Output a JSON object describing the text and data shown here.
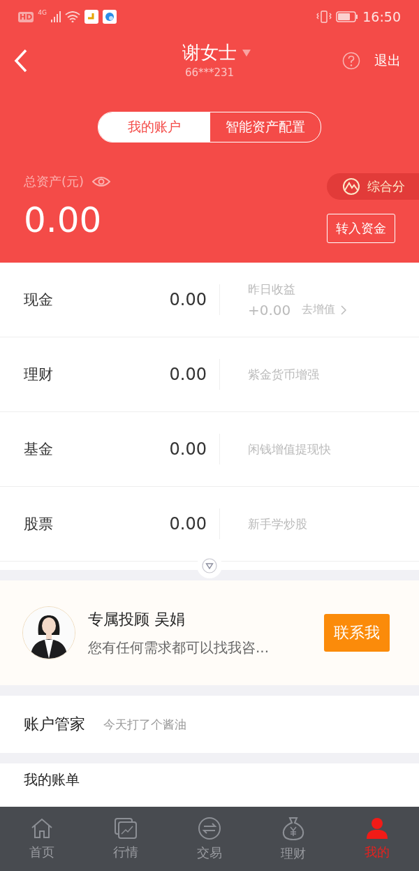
{
  "status_bar": {
    "hd": "HD",
    "network": "4G",
    "time": "16:50"
  },
  "header": {
    "title": "谢女士",
    "account": "66***231",
    "exit": "退出"
  },
  "tabs": [
    {
      "label": "我的账户",
      "selected": true
    },
    {
      "label": "智能资产配置",
      "selected": false
    }
  ],
  "assets": {
    "label": "总资产(元)",
    "value": "0.00",
    "score": "综合分",
    "transfer_button": "转入资金"
  },
  "holdings": [
    {
      "kind": "yield",
      "name": "现金",
      "amount": "0.00",
      "note_label": "昨日收益",
      "note_value": "+0.00",
      "link": "去增值"
    },
    {
      "kind": "tip",
      "name": "理财",
      "amount": "0.00",
      "note": "紫金货币增强"
    },
    {
      "kind": "tip",
      "name": "基金",
      "amount": "0.00",
      "note": "闲钱增值提现快"
    },
    {
      "kind": "tip",
      "name": "股票",
      "amount": "0.00",
      "note": "新手学炒股"
    }
  ],
  "advisor": {
    "title": "专属投顾 吴娟",
    "message": "您有任何需求都可以找我咨...",
    "button": "联系我"
  },
  "manager": {
    "label": "账户管家",
    "note": "今天打了个酱油"
  },
  "bill": {
    "label": "我的账单"
  },
  "nav": [
    {
      "kind": "home",
      "label": "首页",
      "selected": false
    },
    {
      "kind": "market",
      "label": "行情",
      "selected": false
    },
    {
      "kind": "trade",
      "label": "交易",
      "selected": false
    },
    {
      "kind": "finance",
      "label": "理财",
      "selected": false
    },
    {
      "kind": "me",
      "label": "我的",
      "selected": true
    }
  ]
}
